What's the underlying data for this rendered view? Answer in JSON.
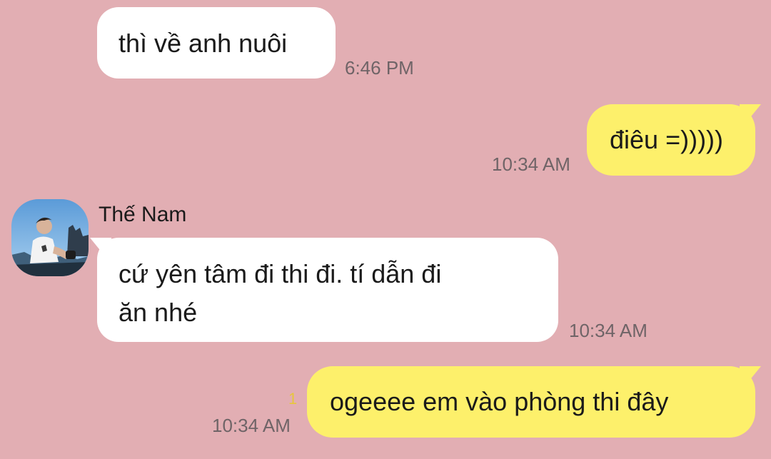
{
  "colors": {
    "background": "#e2aeb3",
    "incoming_bubble": "#ffffff",
    "outgoing_bubble": "#fdf06b",
    "timestamp": "#6f6467",
    "unread_count": "#e7c63c"
  },
  "messages": [
    {
      "direction": "incoming",
      "text": "thì về anh nuôi",
      "time": "6:46 PM"
    },
    {
      "direction": "outgoing",
      "text": "điêu =)))))",
      "time": "10:34 AM"
    },
    {
      "direction": "incoming",
      "sender": "Thế Nam",
      "avatar": "profile-photo",
      "lines": [
        "cứ yên tâm đi thi đi. tí dẫn đi",
        "ăn nhé"
      ],
      "time": "10:34 AM"
    },
    {
      "direction": "outgoing",
      "text": "ogeeee em vào phòng thi đây",
      "time": "10:34 AM",
      "unread": "1"
    }
  ]
}
